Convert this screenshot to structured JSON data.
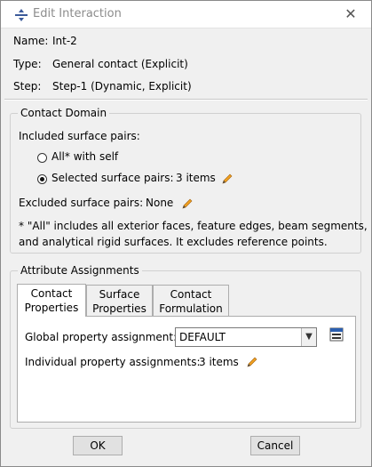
{
  "window": {
    "title": "Edit Interaction",
    "close_glyph": "✕"
  },
  "info": {
    "name_label": "Name:",
    "name_value": "Int-2",
    "type_label": "Type:",
    "type_value": "General contact (Explicit)",
    "step_label": "Step:",
    "step_value": "Step-1 (Dynamic, Explicit)"
  },
  "contact_domain": {
    "title": "Contact Domain",
    "included_label": "Included surface pairs:",
    "options": [
      {
        "label": "All* with self",
        "selected": false
      },
      {
        "label": "Selected surface pairs:",
        "selected": true,
        "count": "3 items"
      }
    ],
    "excluded_label": "Excluded surface pairs:",
    "excluded_value": "None",
    "note_line1": "* \"All\" includes all exterior faces, feature edges, beam segments,",
    "note_line2": "and analytical rigid surfaces. It excludes reference points."
  },
  "attributes": {
    "title": "Attribute Assignments",
    "tabs": [
      {
        "line1": "Contact",
        "line2": "Properties",
        "active": true
      },
      {
        "line1": "Surface",
        "line2": "Properties",
        "active": false
      },
      {
        "line1": "Contact",
        "line2": "Formulation",
        "active": false
      }
    ],
    "global_label": "Global property assignment:",
    "global_value": "DEFAULT",
    "individual_label": "Individual property assignments:",
    "individual_value": "3 items"
  },
  "buttons": {
    "ok": "OK",
    "cancel": "Cancel"
  },
  "icons": {
    "app": "interaction-icon",
    "edit": "pencil-icon",
    "table": "property-table-icon",
    "dropdown": "chevron-down-icon"
  },
  "colors": {
    "title_text": "#8c8c8c",
    "pencil": "#f0a020",
    "dialog_bg": "#f0f0f0"
  }
}
